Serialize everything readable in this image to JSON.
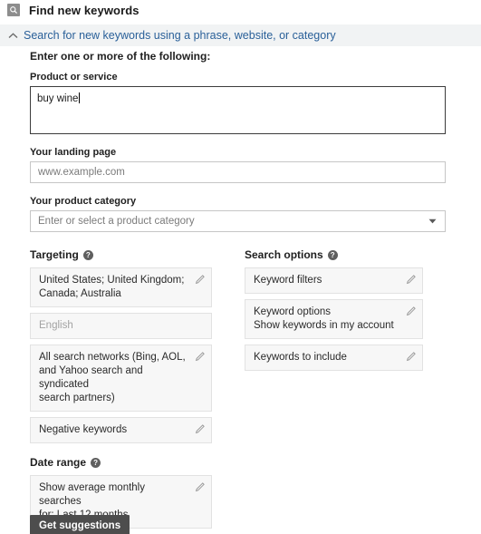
{
  "header": {
    "icon": "search-box-icon",
    "title": "Find new keywords"
  },
  "panel": {
    "toggle_icon": "chevron-up-icon",
    "label": "Search for new keywords using a phrase, website, or category",
    "link_color": "#2a6099",
    "background": "#f1f3f4"
  },
  "form": {
    "intro_heading": "Enter one or more of the following:",
    "product_or_service": {
      "label": "Product or service",
      "value": "buy wine",
      "focused": true
    },
    "landing_page": {
      "label": "Your landing page",
      "placeholder": "www.example.com",
      "value": ""
    },
    "product_category": {
      "label": "Your product category",
      "placeholder": "Enter or select a product category",
      "value": "",
      "arrow_icon": "caret-down-icon"
    }
  },
  "targeting": {
    "title": "Targeting",
    "help_icon": "help-icon",
    "help_glyph": "?",
    "items": [
      {
        "line1": "United States; United Kingdom;",
        "line2": "Canada; Australia",
        "editable": true,
        "edit_icon": "pencil-icon"
      },
      {
        "line1": "English",
        "line2": "",
        "editable": false,
        "disabled": true
      },
      {
        "line1": "All search networks (Bing, AOL,",
        "line2": "and Yahoo search and syndicated",
        "line3": "search partners)",
        "editable": true,
        "edit_icon": "pencil-icon"
      },
      {
        "line1": "Negative keywords",
        "line2": "",
        "editable": true,
        "edit_icon": "pencil-icon"
      }
    ]
  },
  "search_options": {
    "title": "Search options",
    "help_icon": "help-icon",
    "help_glyph": "?",
    "items": [
      {
        "line1": "Keyword filters",
        "line2": "",
        "editable": true,
        "edit_icon": "pencil-icon"
      },
      {
        "line1": "Keyword options",
        "line2": "Show keywords in my account",
        "editable": true,
        "edit_icon": "pencil-icon"
      },
      {
        "line1": "Keywords to include",
        "line2": "",
        "editable": true,
        "edit_icon": "pencil-icon"
      }
    ]
  },
  "date_range": {
    "title": "Date range",
    "help_icon": "help-icon",
    "help_glyph": "?",
    "items": [
      {
        "line1": "Show average monthly searches",
        "line2": "for: Last 12 months",
        "editable": true,
        "edit_icon": "pencil-icon"
      }
    ]
  },
  "actions": {
    "submit_label": "Get suggestions",
    "submit_color": "#4d4d4d"
  }
}
